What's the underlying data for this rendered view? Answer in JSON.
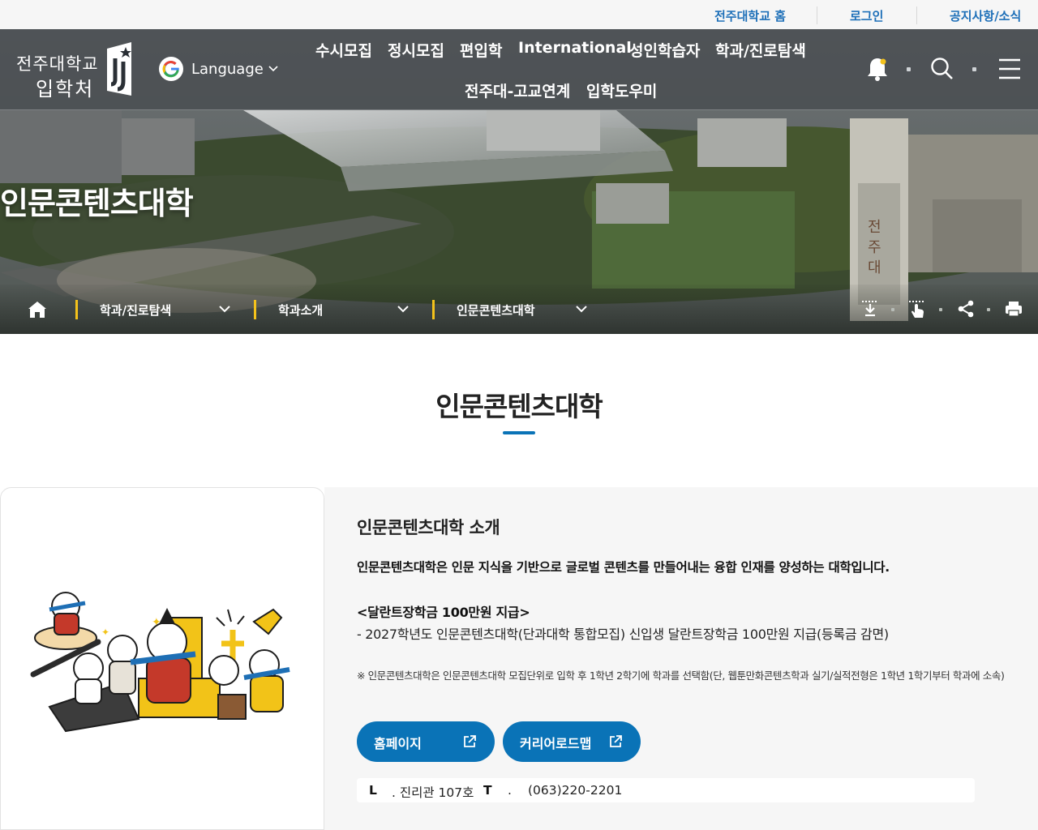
{
  "util_links": {
    "home": "전주대학교 홈",
    "login": "로그인",
    "notice": "공지사항/소식"
  },
  "logo": {
    "line1": "전주대학교",
    "line2": "입학처"
  },
  "language": {
    "label": "Language",
    "icon": "google-icon"
  },
  "gnb": {
    "items": [
      "수시모집",
      "정시모집",
      "편입학",
      "International",
      "성인학습자",
      "학과/진로탐색",
      "전주대-고교연계",
      "입학도우미"
    ]
  },
  "header_icons": [
    "bell-icon",
    "search-icon",
    "menu-icon"
  ],
  "hero": {
    "title": "인문콘텐츠대학"
  },
  "breadcrumb": {
    "home_icon": "home-icon",
    "levels": [
      "학과/진로탐색",
      "학과소개",
      "인문콘텐츠대학"
    ],
    "tools": [
      "download-icon",
      "touch-icon",
      "share-icon",
      "print-icon"
    ]
  },
  "colors": {
    "accent": "#0a73b7",
    "util_link": "#1d6fb8",
    "breadcrumb_sep": "#f4c21b",
    "panel_bg": "#f6f6f6"
  },
  "content": {
    "page_title": "인문콘텐츠대학",
    "section_title": "인문콘텐츠대학 소개",
    "lead": "인문콘텐츠대학은 인문 지식을 기반으로 글로벌 콘텐츠를 만들어내는 융합 인재를 양성하는 대학입니다.",
    "sub_heading": "<달란트장학금 100만원 지급>",
    "sub_body": "- 2027학년도 인문콘텐츠대학(단과대학 통합모집) 신입생 달란트장학금 100만원 지급(등록금 감면)",
    "note": "※ 인문콘텐츠대학은 인문콘텐츠대학 모집단위로 입학 후 1학년 2학기에 학과를 선택함(단, 웹툰만화콘텐츠학과 실기/실적전형은 1학년 1학기부터 학과에 소속)",
    "buttons": {
      "homepage": "홈페이지",
      "roadmap": "커리어로드맵"
    },
    "contact": {
      "location_key": "L",
      "location_value": ". 진리관 107호",
      "tel_key": "T",
      "tel_sep": ".",
      "tel_value": "(063)220-2201"
    }
  }
}
